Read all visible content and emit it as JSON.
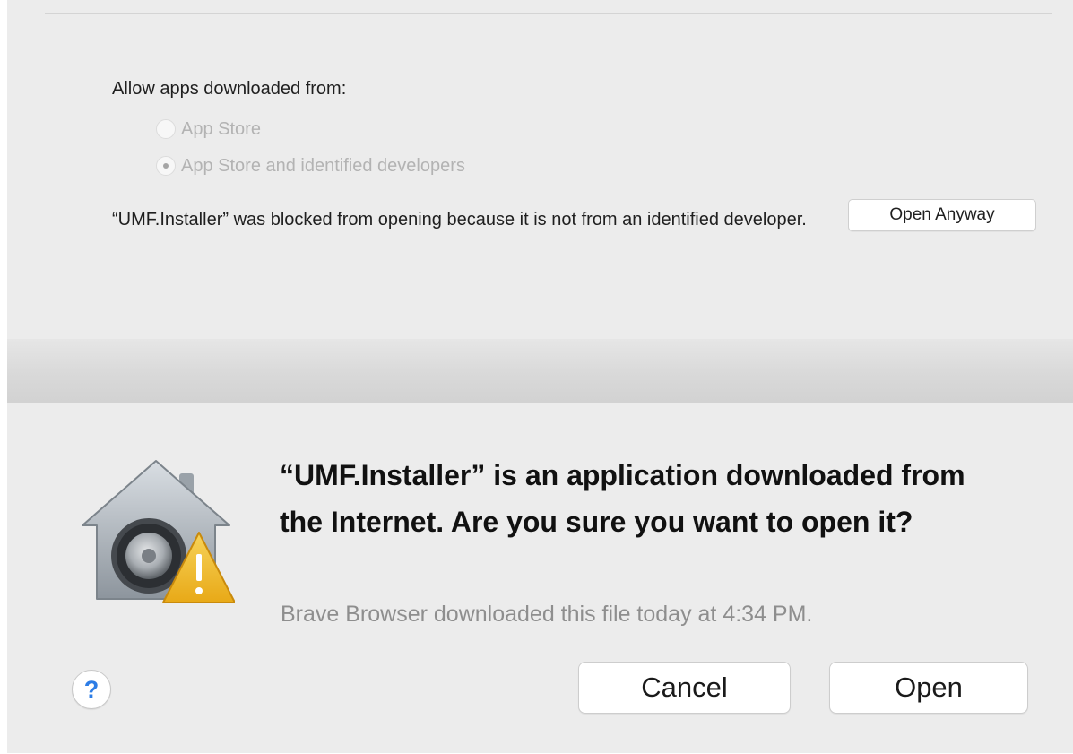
{
  "security_pane": {
    "allow_heading": "Allow apps downloaded from:",
    "radio_options": [
      {
        "label": "App Store",
        "selected": false,
        "enabled": false
      },
      {
        "label": "App Store and identified developers",
        "selected": true,
        "enabled": false
      }
    ],
    "blocked_message": "“UMF.Installer” was blocked from opening because it is not from an identified developer.",
    "open_anyway_label": "Open Anyway"
  },
  "dialog": {
    "icon": "gatekeeper-house-lock-warning-icon",
    "title": "“UMF.Installer” is an application downloaded from the Internet. Are you sure you want to open it?",
    "subtitle": "Brave Browser downloaded this file today at 4:34 PM.",
    "help_label": "?",
    "cancel_label": "Cancel",
    "open_label": "Open"
  },
  "colors": {
    "pane_background": "#ececec",
    "help_blue": "#2d7de6",
    "warning_yellow": "#f1c232",
    "disabled_text": "#b3b3b3"
  }
}
